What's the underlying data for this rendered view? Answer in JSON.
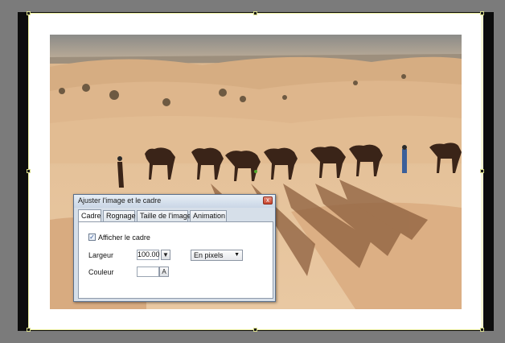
{
  "dialog": {
    "title": "Ajuster l'image et le cadre",
    "close_glyph": "x",
    "tabs": [
      {
        "label": "Cadre",
        "active": true
      },
      {
        "label": "Rognage",
        "active": false
      },
      {
        "label": "Taille de l'image",
        "active": false
      },
      {
        "label": "Animation",
        "active": false
      }
    ],
    "show_frame_label": "Afficher le cadre",
    "show_frame_checked": true,
    "width_label": "Largeur",
    "width_value": "100.00",
    "unit_select": "En pixels",
    "color_label": "Couleur",
    "color_button": "A"
  },
  "icons": {
    "check": "check-icon",
    "dropdown": "chevron-down-icon",
    "close": "close-icon"
  },
  "colors": {
    "background": "#7b7b7b",
    "frame": "#ffffff",
    "border": "#0d0d0d",
    "selection": "#e8ec9a"
  }
}
